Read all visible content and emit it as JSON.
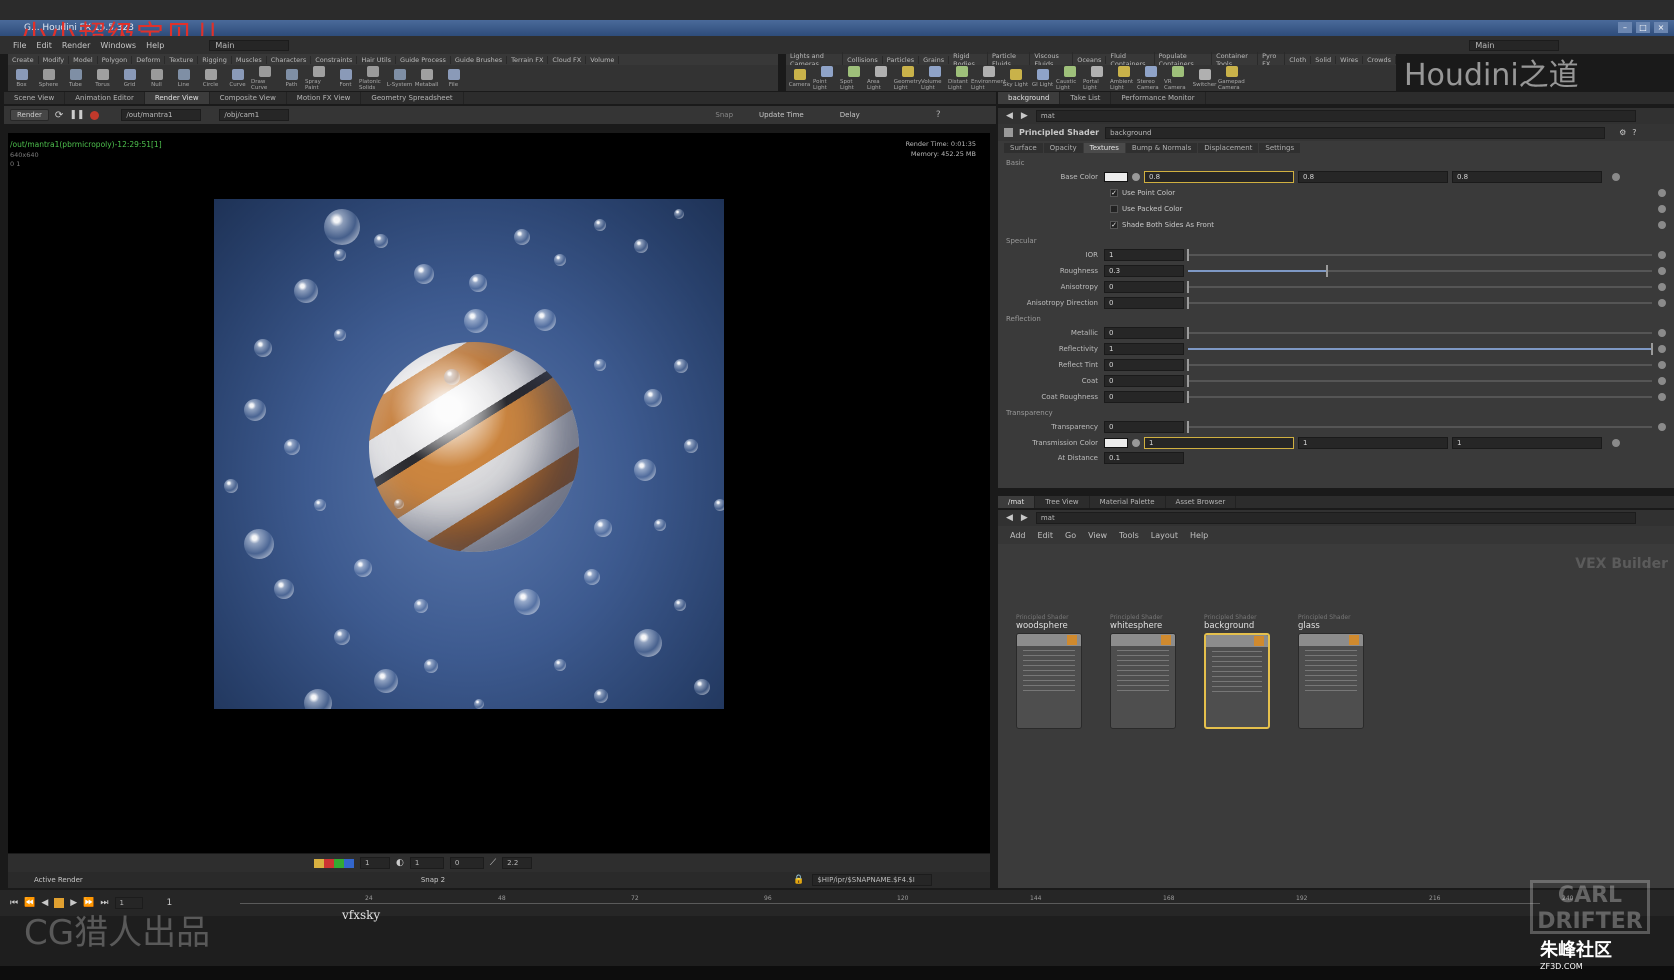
{
  "window": {
    "title": "G... Houdini FX 15.5.323",
    "watermark_cn": "小小超级宝贝儿",
    "desktop": "Main",
    "right_desktop": "Main"
  },
  "menubar": [
    "File",
    "Edit",
    "Render",
    "Windows",
    "Help"
  ],
  "shelf": {
    "left_tabs": [
      "Create",
      "Modify",
      "Model",
      "Polygon",
      "Deform",
      "Texture",
      "Rigging",
      "Muscles",
      "Characters",
      "Constraints",
      "Hair Utils",
      "Guide Process",
      "Guide Brushes",
      "Terrain FX",
      "Cloud FX",
      "Volume"
    ],
    "left_tools": [
      "Box",
      "Sphere",
      "Tube",
      "Torus",
      "Grid",
      "Null",
      "Line",
      "Circle",
      "Curve",
      "Draw Curve",
      "Path",
      "Spray Paint",
      "Font",
      "Platonic Solids",
      "L-System",
      "Metaball",
      "File"
    ],
    "right_tabs": [
      "Lights and Cameras",
      "Collisions",
      "Particles",
      "Grains",
      "Rigid Bodies",
      "Particle Fluids",
      "Viscous Fluids",
      "Oceans",
      "Fluid Containers",
      "Populate Containers",
      "Container Tools",
      "Pyro FX",
      "Cloth",
      "Solid",
      "Wires",
      "Crowds"
    ],
    "right_tools": [
      "Camera",
      "Point Light",
      "Spot Light",
      "Area Light",
      "Geometry Light",
      "Volume Light",
      "Distant Light",
      "Environment Light",
      "Sky Light",
      "GI Light",
      "Caustic Light",
      "Portal Light",
      "Ambient Light",
      "Stereo Camera",
      "VR Camera",
      "Switcher",
      "Gamepad Camera"
    ]
  },
  "left_pane_tabs": [
    "Scene View",
    "Animation Editor",
    "Render View",
    "Composite View",
    "Motion FX View",
    "Geometry Spreadsheet"
  ],
  "render_toolbar": {
    "render_label": "Render",
    "rop_path": "/out/mantra1",
    "camera_path": "/obj/cam1",
    "snap_label": "Snap",
    "update_time": "Update Time",
    "delay": "Delay"
  },
  "viewport": {
    "render_info": "/out/mantra1(pbrmicropoly)-12:29:51[1]",
    "resolution": "640x640",
    "coords": "0 1",
    "render_time": "Render Time: 0:01:35",
    "memory": "Memory:  452.25 MB"
  },
  "viewport_bottom": {
    "gamma": "2.2",
    "exposure": "0",
    "val1": "1",
    "val2": "1",
    "snap": "Snap 2",
    "active_render": "Active Render",
    "output_path": "$HIP/ipr/$SNAPNAME.$F4.$I"
  },
  "timeline": {
    "frame": "1",
    "start": "1",
    "ticks": [
      "24",
      "48",
      "72",
      "96",
      "120",
      "144",
      "168",
      "192",
      "216",
      "240"
    ]
  },
  "right_top_tabs": [
    "background",
    "Take List",
    "Performance Monitor"
  ],
  "param_path": "mat",
  "params": {
    "node_type": "Principled Shader",
    "node_name": "background",
    "tabs": [
      "Surface",
      "Opacity",
      "Textures",
      "Bump & Normals",
      "Displacement",
      "Settings"
    ],
    "sections": {
      "basic": "Basic",
      "specular": "Specular",
      "reflection": "Reflection",
      "transparency": "Transparency"
    },
    "base_color": {
      "label": "Base Color",
      "r": "0.8",
      "g": "0.8",
      "b": "0.8"
    },
    "checks": [
      {
        "label": "Use Point Color",
        "checked": true
      },
      {
        "label": "Use Packed Color",
        "checked": false
      },
      {
        "label": "Shade Both Sides As Front",
        "checked": true
      }
    ],
    "specular_rows": [
      {
        "label": "IOR",
        "value": "1",
        "fill": 0.0
      },
      {
        "label": "Roughness",
        "value": "0.3",
        "fill": 0.3
      },
      {
        "label": "Anisotropy",
        "value": "0",
        "fill": 0.0
      },
      {
        "label": "Anisotropy Direction",
        "value": "0",
        "fill": 0.0
      }
    ],
    "reflection_rows": [
      {
        "label": "Metallic",
        "value": "0",
        "fill": 0.0
      },
      {
        "label": "Reflectivity",
        "value": "1",
        "fill": 1.0
      },
      {
        "label": "Reflect Tint",
        "value": "0",
        "fill": 0.0
      },
      {
        "label": "Coat",
        "value": "0",
        "fill": 0.0
      },
      {
        "label": "Coat Roughness",
        "value": "0",
        "fill": 0.0
      }
    ],
    "transparency_rows": [
      {
        "label": "Transparency",
        "value": "0",
        "fill": 0.0
      }
    ],
    "transmission_color": {
      "label": "Transmission Color",
      "r": "1",
      "g": "1",
      "b": "1"
    },
    "at_distance": {
      "label": "At Distance",
      "value": "0.1"
    }
  },
  "network": {
    "tabs": [
      "/mat",
      "Tree View",
      "Material Palette",
      "Asset Browser"
    ],
    "path": "mat",
    "menu": [
      "Add",
      "Edit",
      "Go",
      "View",
      "Tools",
      "Layout",
      "Help"
    ],
    "context_label": "VEX Builder",
    "nodes": [
      {
        "type": "Principled Shader",
        "name": "woodsphere",
        "selected": false
      },
      {
        "type": "Principled Shader",
        "name": "whitesphere",
        "selected": false
      },
      {
        "type": "Principled Shader",
        "name": "background",
        "selected": true
      },
      {
        "type": "Principled Shader",
        "name": "glass",
        "selected": false
      }
    ]
  },
  "overlays": {
    "houdini_brand": "Houdini之道",
    "cg_logo": "CG猎人出品",
    "vfxsky": "vfxsky",
    "cartd": "CARL DRIFTER",
    "zf3d": "朱峰社区",
    "zf3d_url": "ZF3D.COM"
  }
}
